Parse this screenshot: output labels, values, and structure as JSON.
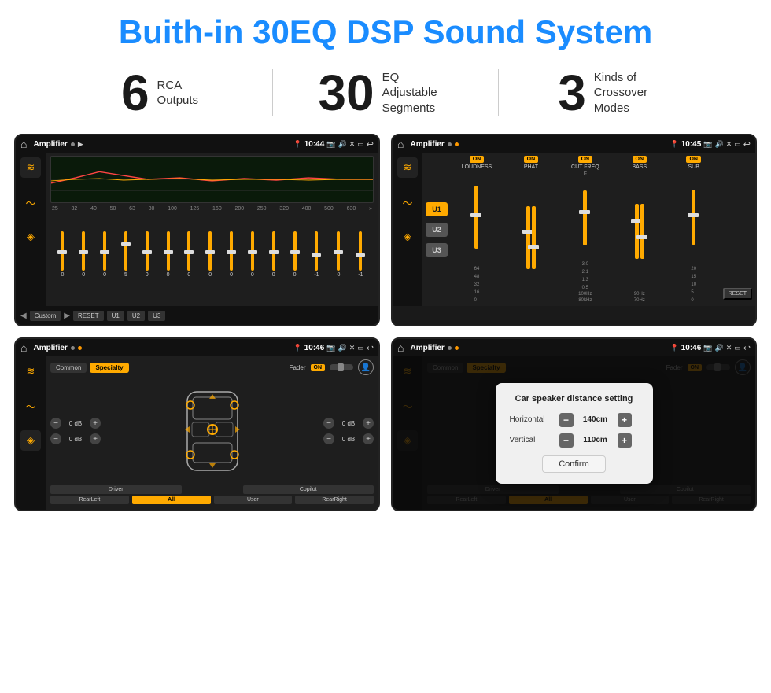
{
  "page": {
    "title": "Buith-in 30EQ DSP Sound System",
    "stats": [
      {
        "number": "6",
        "label": "RCA\nOutputs"
      },
      {
        "number": "30",
        "label": "EQ Adjustable\nSegments"
      },
      {
        "number": "3",
        "label": "Kinds of\nCrossover Modes"
      }
    ]
  },
  "screen_tl": {
    "status": {
      "title": "Amplifier",
      "time": "10:44"
    },
    "freqs": [
      "25",
      "32",
      "40",
      "50",
      "63",
      "80",
      "100",
      "125",
      "160",
      "200",
      "250",
      "320",
      "400",
      "500",
      "630"
    ],
    "values": [
      "0",
      "0",
      "0",
      "5",
      "0",
      "0",
      "0",
      "0",
      "0",
      "0",
      "0",
      "0",
      "-1",
      "0",
      "-1"
    ],
    "preset": "Custom",
    "buttons": [
      "RESET",
      "U1",
      "U2",
      "U3"
    ]
  },
  "screen_tr": {
    "status": {
      "title": "Amplifier",
      "time": "10:45"
    },
    "channels": [
      "U1",
      "U2",
      "U3"
    ],
    "controls": [
      {
        "label": "LOUDNESS",
        "on": true
      },
      {
        "label": "PHAT",
        "on": true
      },
      {
        "label": "CUT FREQ",
        "on": true
      },
      {
        "label": "BASS",
        "on": true
      },
      {
        "label": "SUB",
        "on": true
      }
    ],
    "reset_label": "RESET"
  },
  "screen_bl": {
    "status": {
      "title": "Amplifier",
      "time": "10:46"
    },
    "tabs": [
      "Common",
      "Specialty"
    ],
    "active_tab": "Specialty",
    "fader_label": "Fader",
    "fader_on": "ON",
    "volumes": [
      "0 dB",
      "0 dB",
      "0 dB",
      "0 dB"
    ],
    "buttons": [
      "Driver",
      "Copilot",
      "RearLeft",
      "All",
      "User",
      "RearRight"
    ]
  },
  "screen_br": {
    "status": {
      "title": "Amplifier",
      "time": "10:46"
    },
    "tabs": [
      "Common",
      "Specialty"
    ],
    "dialog": {
      "title": "Car speaker distance setting",
      "horizontal_label": "Horizontal",
      "horizontal_value": "140cm",
      "vertical_label": "Vertical",
      "vertical_value": "110cm",
      "confirm_label": "Confirm"
    },
    "buttons": [
      "Driver",
      "Copilot",
      "RearLeft",
      "All",
      "User",
      "RearRight"
    ]
  },
  "icons": {
    "home": "⌂",
    "play": "▶",
    "back": "↩",
    "eq_icon": "≋",
    "wave_icon": "〜",
    "speaker_icon": "◈",
    "camera": "📷",
    "volume": "🔊",
    "minus": "—",
    "plus": "+"
  }
}
